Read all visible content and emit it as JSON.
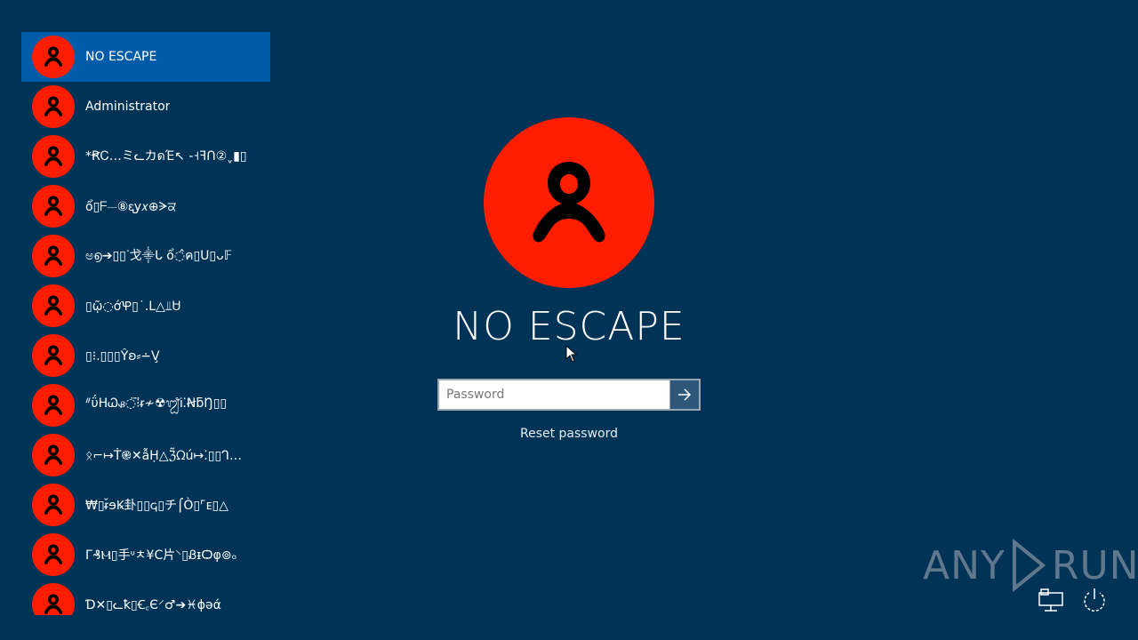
{
  "users": [
    {
      "name": "NO ESCAPE",
      "selected": true
    },
    {
      "name": "Administrator"
    },
    {
      "name": "*ꞦᏟ…ミᓚカดΈ↖ -˧ꟻᑎ②ˬ▮▯"
    },
    {
      "name": "ổ▯ᖴ⏤⑧ᶓy𝑥⊕ᗒਕ"
    },
    {
      "name": "ಅ൭➔▯▯ᐝ戈⸎ᒐ ổ◌̂ค▯ᑌ▯ᴗ𝔽"
    },
    {
      "name": "▯ῷ◌ớꝔ▯˙.ᒪ△⫫Ꮜ"
    },
    {
      "name": "▯⁝.▯▯▯Ŷʚ⸗∸V̧"
    },
    {
      "name": "ᐥΰHᏇᏸ◌̈⁝̈ᵲ≁☢ᬐᎥ⁚ꞤƃŊ▯▯"
    },
    {
      "name": "ᛟ⌐↦Ṫ֎✕ẫḤ△ℨ̃ᘯú↦⁚▯▯ᒉ…"
    },
    {
      "name": "₩▯ᵲ̌ɘꝂ卦▯▯𐌾▯チ⌠Ò▯⌜ᴇ▯△"
    },
    {
      "name": "Г₰Ⲙ▯手ᶸㅊ¥C片⸌▯ᏰᵻѺφ⊚ₒ"
    },
    {
      "name": "Ɗ✕▯ᓚꝁ▯Ꞓ꜀Є⸍♂➔♓ɸəά"
    }
  ],
  "selected_user": "NO ESCAPE",
  "password": {
    "placeholder": "Password",
    "value": ""
  },
  "reset_label": "Reset password",
  "watermark": {
    "left": "ANY",
    "right": "RUN"
  },
  "icons": {
    "user": "user-icon",
    "submit": "arrow-right-icon",
    "network": "network-icon",
    "power": "power-icon"
  },
  "colors": {
    "background": "#003356",
    "avatar": "#ff1d00",
    "selected_row": "#005ba8"
  }
}
